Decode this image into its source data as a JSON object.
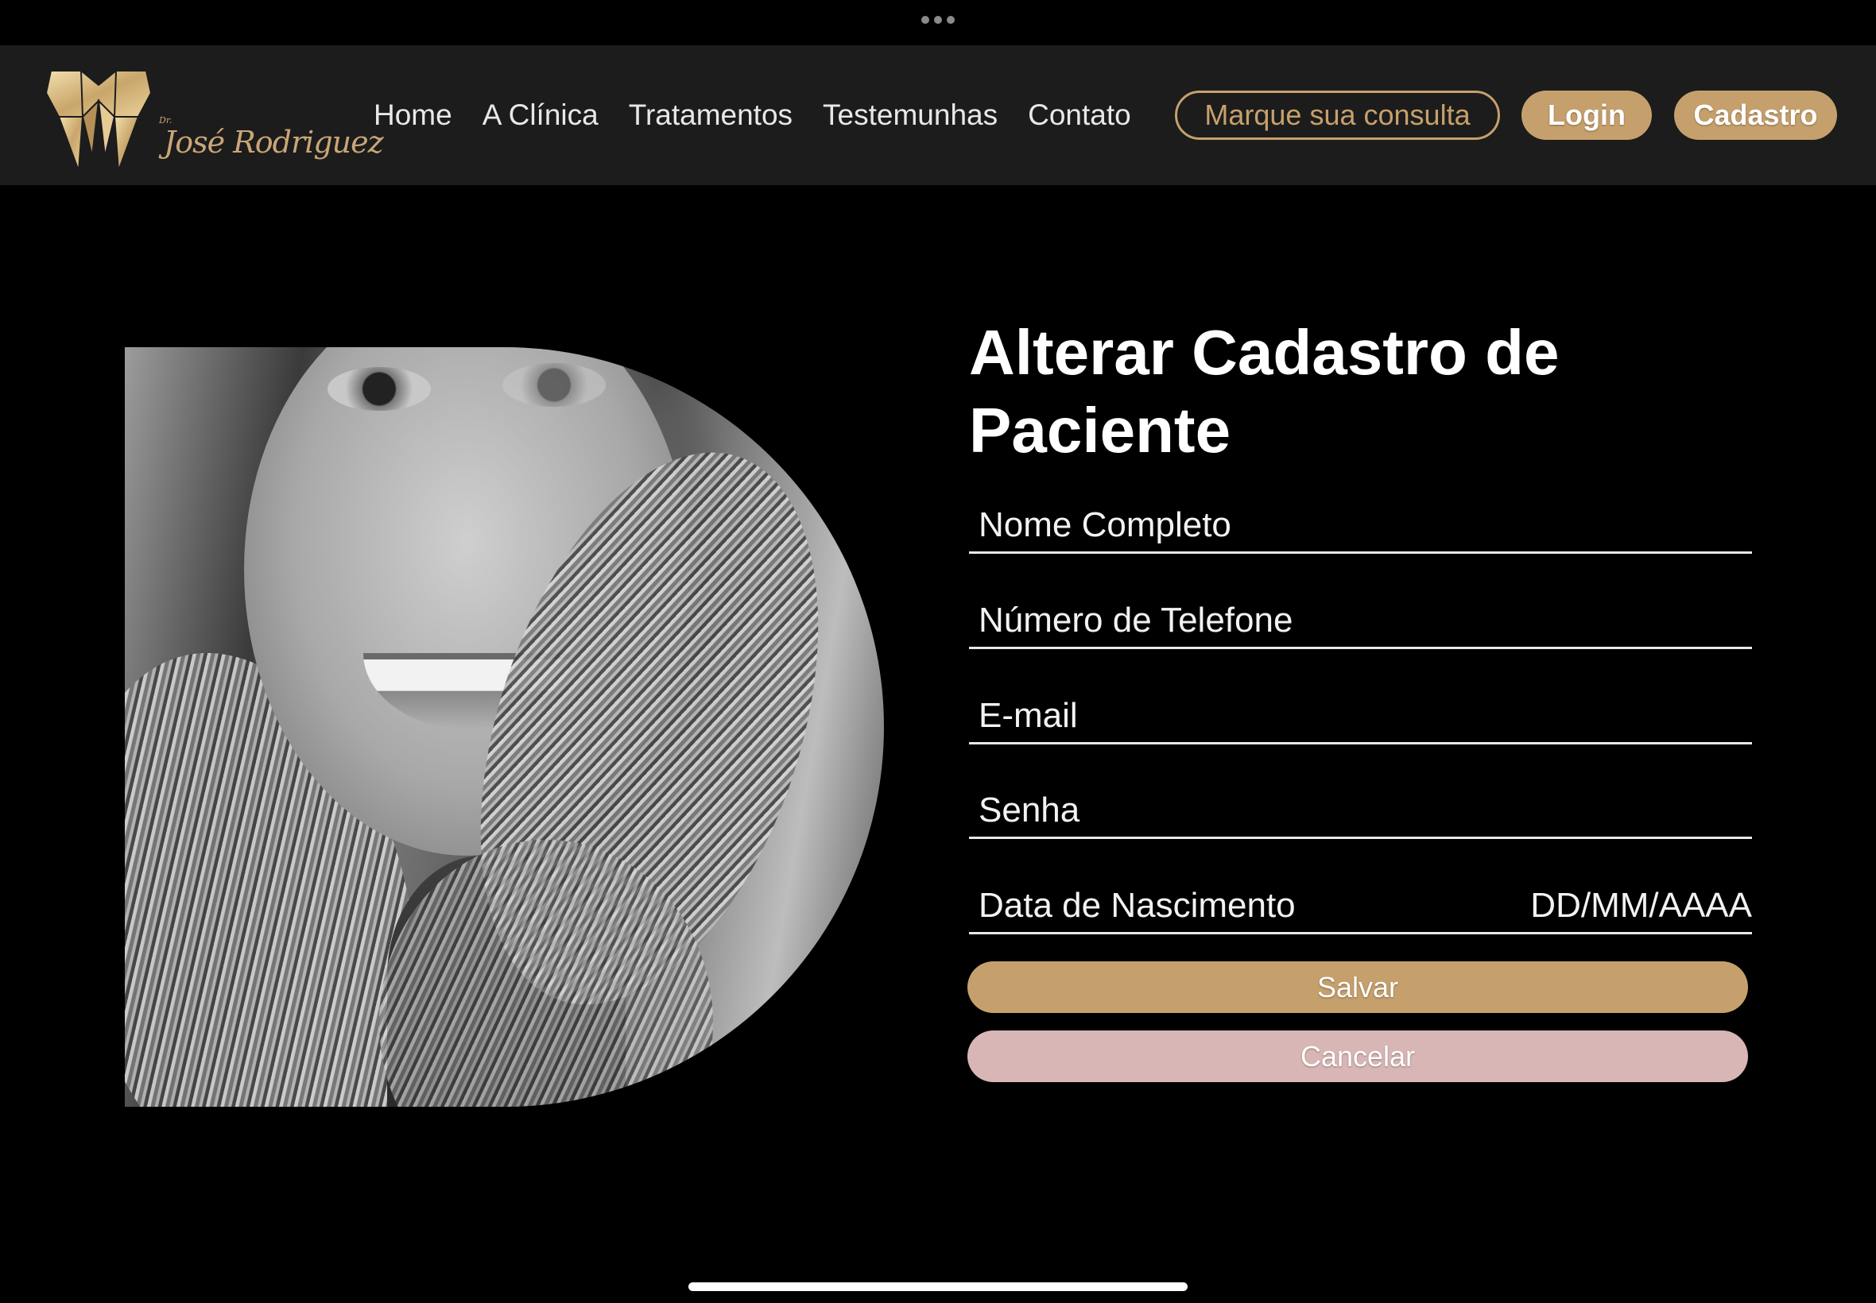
{
  "status_bar": {
    "icon": "more-dots-icon"
  },
  "header": {
    "logo": {
      "prefix": "Dr.",
      "name": "José Rodriguez",
      "icon": "tooth-logo-icon",
      "color": "#c9a676"
    },
    "nav": [
      {
        "label": "Home"
      },
      {
        "label": "A Clínica"
      },
      {
        "label": "Tratamentos"
      },
      {
        "label": "Testemunhas"
      },
      {
        "label": "Contato"
      }
    ],
    "appointment_button": "Marque sua consulta",
    "login_button": "Login",
    "signup_button": "Cadastro"
  },
  "main": {
    "title": "Alterar Cadastro de Paciente",
    "fields": {
      "full_name": {
        "label": "Nome Completo"
      },
      "phone": {
        "label": "Número de Telefone"
      },
      "email": {
        "label": "E-mail"
      },
      "password": {
        "label": "Senha"
      },
      "birth_date": {
        "label": "Data de Nascimento",
        "hint": "DD/MM/AAAA"
      }
    },
    "save_button": "Salvar",
    "cancel_button": "Cancelar"
  },
  "colors": {
    "accent": "#c6a06c",
    "cancel": "#d9b6b6",
    "nav_background": "#1c1c1c",
    "page_background": "#000000"
  }
}
